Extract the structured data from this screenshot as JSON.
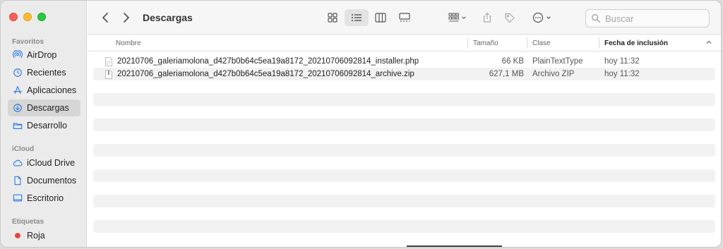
{
  "window": {
    "title": "Descargas"
  },
  "sidebar": {
    "favorites_label": "Favoritos",
    "favorites": [
      {
        "label": "AirDrop",
        "icon": "airdrop-icon"
      },
      {
        "label": "Recientes",
        "icon": "clock-icon"
      },
      {
        "label": "Aplicaciones",
        "icon": "apps-icon"
      },
      {
        "label": "Descargas",
        "icon": "download-icon",
        "selected": true
      },
      {
        "label": "Desarrollo",
        "icon": "folder-icon"
      }
    ],
    "icloud_label": "iCloud",
    "icloud": [
      {
        "label": "iCloud Drive",
        "icon": "cloud-icon"
      },
      {
        "label": "Documentos",
        "icon": "document-icon"
      },
      {
        "label": "Escritorio",
        "icon": "desktop-icon"
      }
    ],
    "tags_label": "Etiquetas",
    "tags": [
      {
        "label": "Roja",
        "color": "#e6453d"
      }
    ]
  },
  "search": {
    "placeholder": "Buscar"
  },
  "columns": {
    "name": "Nombre",
    "size": "Tamaño",
    "kind": "Clase",
    "date_added": "Fecha de inclusión"
  },
  "files": [
    {
      "name": "20210706_galeriamolona_d427b0b64c5ea19a8172_20210706092814_installer.php",
      "size": "66 KB",
      "kind": "PlainTextType",
      "date": "hoy 11:32"
    },
    {
      "name": "20210706_galeriamolona_d427b0b64c5ea19a8172_20210706092814_archive.zip",
      "size": "627,1 MB",
      "kind": "Archivo ZIP",
      "date": "hoy 11:32"
    }
  ],
  "colors": {
    "sidebar_bg": "#ebebeb",
    "selected_bg": "#d6d6d6",
    "accent": "#2f7de1",
    "alt_row": "#f2f2f2"
  }
}
